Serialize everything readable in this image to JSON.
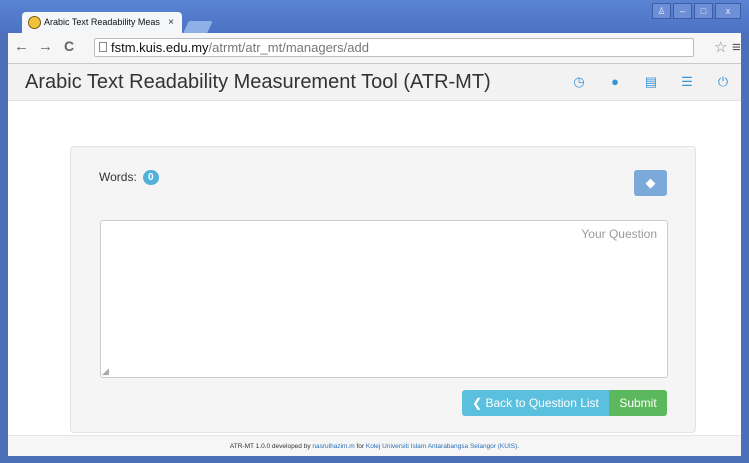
{
  "browser": {
    "tab_title": "Arabic Text Readability Meas",
    "tab_close": "×",
    "window_controls": {
      "user": "♙",
      "minimize": "–",
      "maximize": "□",
      "close": "x"
    },
    "nav": {
      "back": "←",
      "forward": "→",
      "reload": "C"
    },
    "url_host": "fstm.kuis.edu.my",
    "url_path": "/atrmt/atr_mt/managers/add",
    "star": "☆",
    "menu": "≡"
  },
  "navbar": {
    "brand": "Arabic Text Readability Measurement Tool (ATR-MT)",
    "icons": [
      "dashboard-icon",
      "user-icon",
      "inbox-icon",
      "list-icon",
      "power-icon"
    ],
    "icon_glyphs": [
      "◷",
      "●",
      "▤",
      "☰",
      "⏻"
    ]
  },
  "form": {
    "words_label": "Words:",
    "words_count": "0",
    "tag_glyph": "◆",
    "question_placeholder": "Your Question",
    "question_value": "",
    "back_button": "❮ Back to Question List",
    "submit_button": "Submit"
  },
  "footer": {
    "prefix": "ATR-MT 1.0.0 developed by",
    "author": "nasrulhazim.m",
    "middle": "for",
    "org": "Kolej Universiti Islam Antarabangsa Selangor (KUIS)",
    "suffix": "."
  },
  "colors": {
    "brand_blue": "#3a94d6",
    "info": "#5bc0de",
    "success": "#5cb85c",
    "badge": "#52b0d9"
  }
}
